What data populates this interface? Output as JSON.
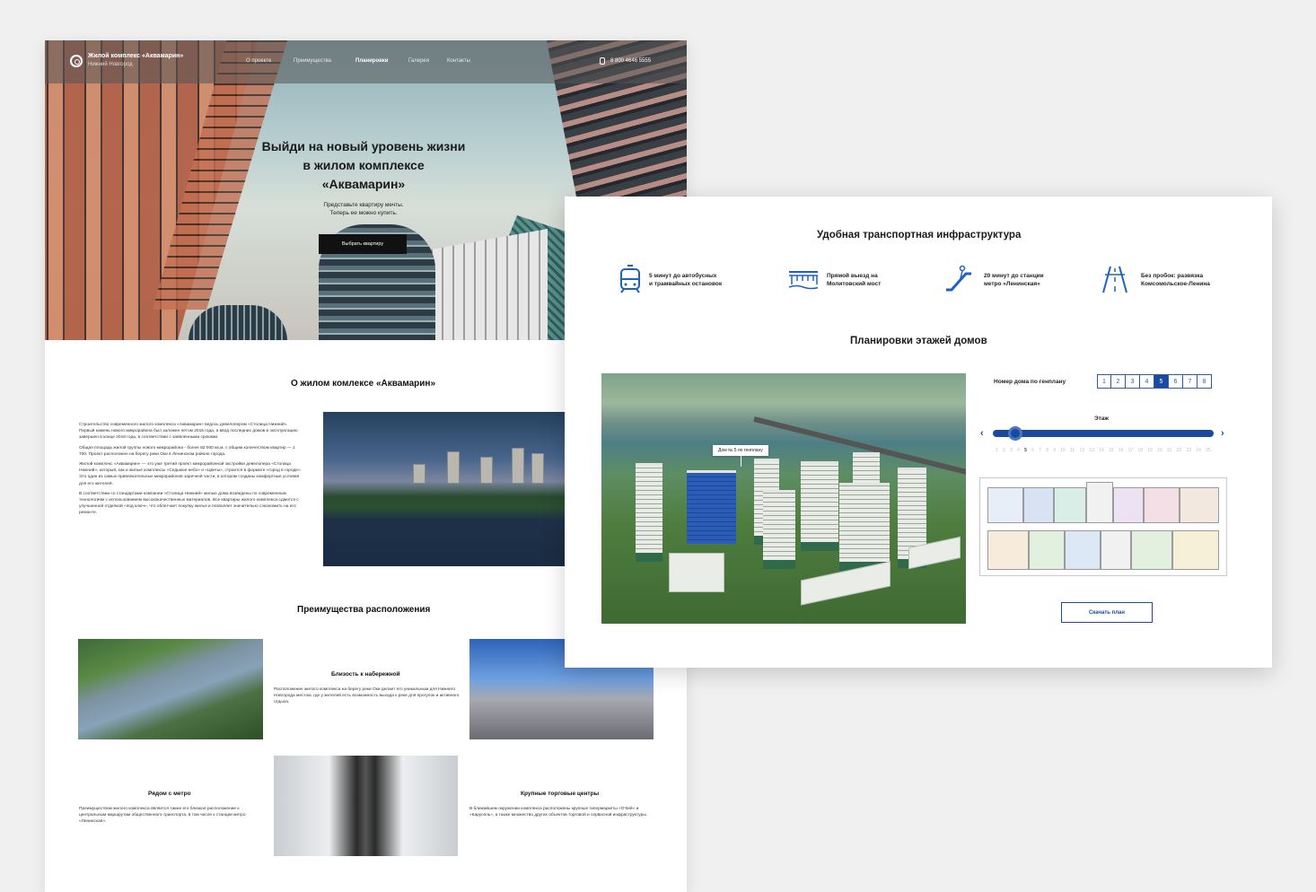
{
  "landing": {
    "brand": {
      "title": "Жилой комплекс «Аквамарин»",
      "city": "Нижний Новгород"
    },
    "nav": [
      "О проекте",
      "Преимущества",
      "Планировки",
      "Галерея",
      "Контакты"
    ],
    "phone": "8 800 4646 5555",
    "hero": {
      "title_lines": [
        "Выйди на новый уровень жизни",
        "в жилом комплексе",
        "«Аквамарин»"
      ],
      "subtitle_lines": [
        "Представьте квартиру мечты.",
        "Теперь ее можно купить."
      ],
      "button": "Выбрать квартиру"
    },
    "about": {
      "title": "О жилом комлексе «Аквамарин»",
      "paragraphs": [
        "Строительство современного жилого комплекса «Аквамарин» ведось девелопером «Столица Нижний». Первый камень нового микрорайона был заложен летом 2015 года, а ввод последних домов в эксплуатацию завершен в конце 2018 года, в соответствии с заявленными сроками.",
        "Общая площадь жилой группы нового микрорайона - более 82 000 кв.м, с общим количеством квартир — 1 700. Проект расположен на берегу реки Оки в Ленинском районе города.",
        "Жилой комплекс «Аквамарин» — это уже третий проект микрорайонной застройки девелопера «Столица Нижний», который, как и жилые комплексы «Седьмое небо» и «Цветы», строится в формате «город в городе». Это один из самых привлекательных микрорайонов заречной части, в котором созданы комфортные условия для его жителей.",
        "В соответствии со стандартами компании «Столица Нижний» жилые дома возведены по современным технологиям с использованием высококачественных материалов. Все квартиры жилого комплекса сдаются с улучшенной отделкой «под ключ», что облегчает покупку жилья и позволяет значительно сэкономить на его ремонте."
      ]
    },
    "advantages": {
      "title": "Преимущества расположения",
      "items": [
        {
          "title": "Близость к набережной",
          "text": "Расположение жилого комплекса на берегу реки Оки делает его уникальным для Нижнего Новгорода местом, где у жителей есть возможность выхода к реке для прогулок и активного отдыха."
        },
        {
          "title": "Рядом с метро",
          "text": "Преимуществом жилого комплекса является также его близкое расположение к центральным маршрутам общественного транспорта, в том числе к станции метро «Ленинская»."
        },
        {
          "title": "Крупные торговые центры",
          "text": "В ближайшем окружении комплекса расположены крупные гипермаркеты «О'Кей» и «Карусель», а также множество других объектов торговой и сервисной инфраструктуры."
        }
      ]
    }
  },
  "plans_page": {
    "transport": {
      "title": "Удобная транспортная инфраструктура",
      "items": [
        {
          "icon": "tram-icon",
          "lines": [
            "5 минут до автобусных",
            "и трамвайных остановок"
          ]
        },
        {
          "icon": "bridge-icon",
          "lines": [
            "Прямой выезд на",
            "Молитовский мост"
          ]
        },
        {
          "icon": "escalator-icon",
          "lines": [
            "20 минут до станции",
            "метро «Ленинская»"
          ]
        },
        {
          "icon": "road-icon",
          "lines": [
            "Без пробок: развязка",
            "Комсомольское-Ленина"
          ]
        }
      ]
    },
    "floors": {
      "title": "Планировки этажей домов",
      "callout": "Дом № 5 по генплану",
      "house_label": "Номер дома по генплану",
      "houses": [
        "1",
        "2",
        "3",
        "4",
        "5",
        "6",
        "7",
        "8"
      ],
      "selected_house": "5",
      "floor_label": "Этаж",
      "floor_numbers": [
        "1",
        "2",
        "3",
        "4",
        "5",
        "6",
        "7",
        "8",
        "9",
        "10",
        "11",
        "12",
        "13",
        "14",
        "15",
        "16",
        "17",
        "18",
        "19",
        "20",
        "21",
        "22",
        "23",
        "24",
        "25"
      ],
      "selected_floor": "5",
      "slider_value": 0.1,
      "download": "Скачать план"
    },
    "accent_color": "#1a4a9e"
  }
}
